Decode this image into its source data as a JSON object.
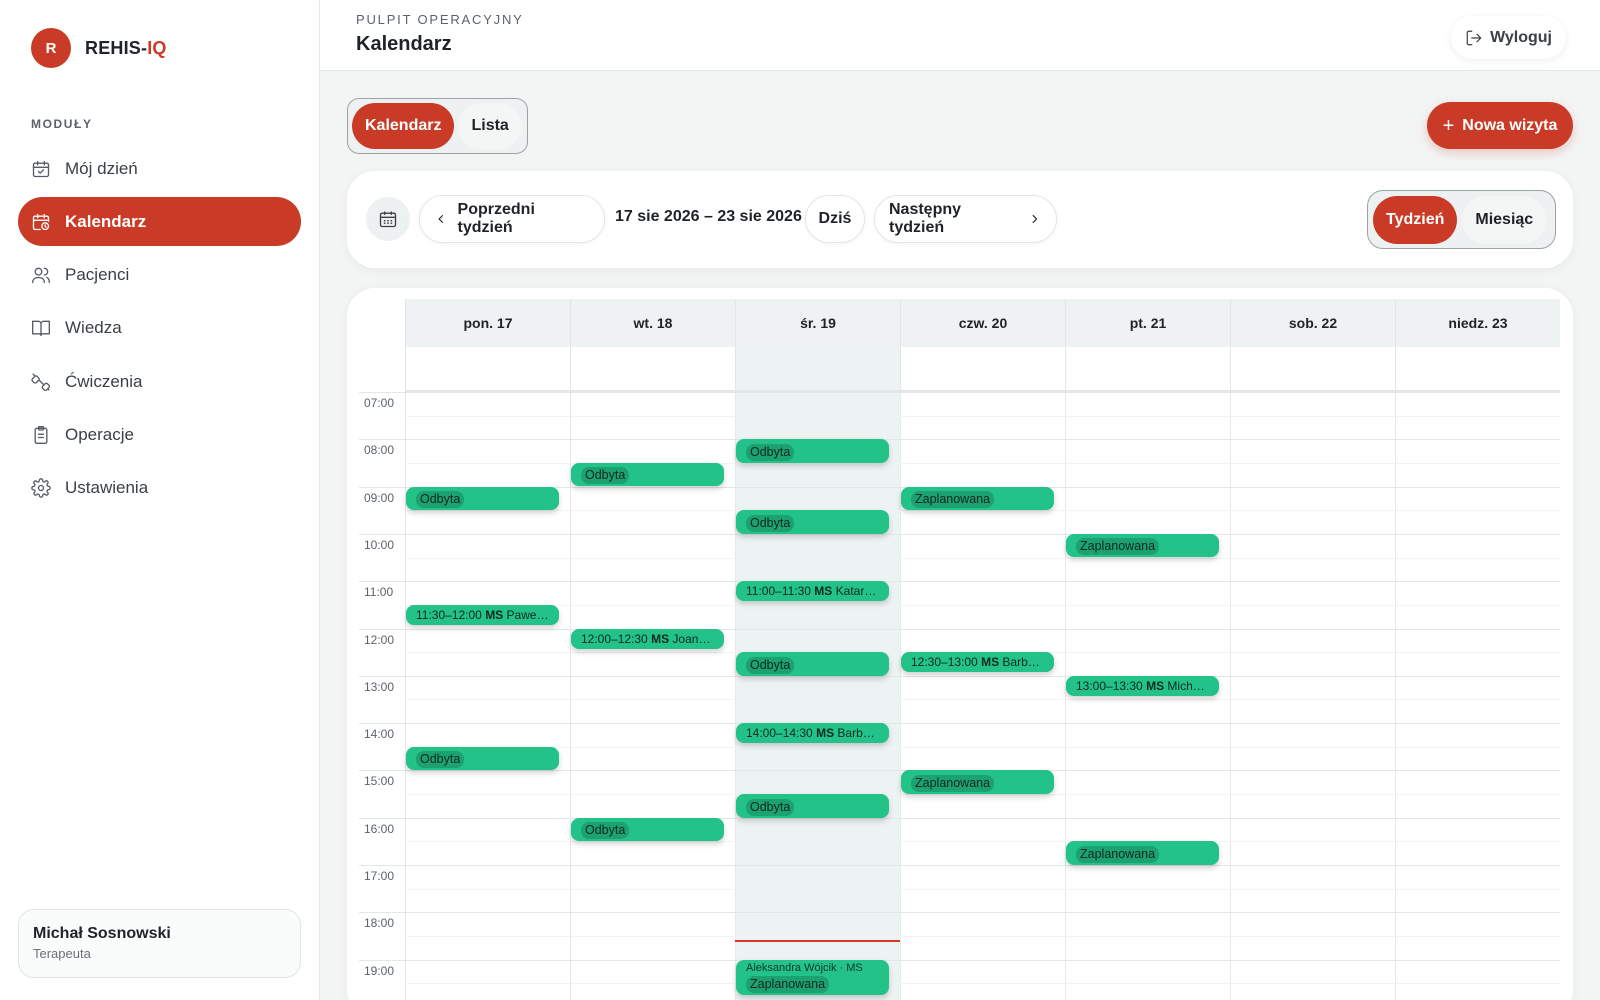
{
  "brand": {
    "initial": "R",
    "name_prefix": "REHIS-",
    "name_accent": "IQ"
  },
  "sidebar": {
    "section_label": "MODUŁY",
    "items": [
      {
        "label": "Mój dzień",
        "icon": "calendar-check-icon",
        "active": false
      },
      {
        "label": "Kalendarz",
        "icon": "calendar-clock-icon",
        "active": true
      },
      {
        "label": "Pacjenci",
        "icon": "users-icon",
        "active": false
      },
      {
        "label": "Wiedza",
        "icon": "book-icon",
        "active": false
      },
      {
        "label": "Ćwiczenia",
        "icon": "dumbbell-icon",
        "active": false
      },
      {
        "label": "Operacje",
        "icon": "clipboard-icon",
        "active": false
      },
      {
        "label": "Ustawienia",
        "icon": "gear-icon",
        "active": false
      }
    ],
    "user": {
      "name": "Michał Sosnowski",
      "role": "Terapeuta"
    }
  },
  "header": {
    "kicker": "PULPIT OPERACYJNY",
    "title": "Kalendarz",
    "logout_label": "Wyloguj"
  },
  "view_switch": {
    "calendar_label": "Kalendarz",
    "list_label": "Lista",
    "active": "Kalendarz"
  },
  "new_visit_label": "Nowa wizyta",
  "toolbar": {
    "prev_label": "Poprzedni tydzień",
    "range": "17 sie 2026 – 23 sie 2026",
    "today_label": "Dziś",
    "next_label": "Następny tydzień",
    "week_label": "Tydzień",
    "month_label": "Miesiąc",
    "active_period": "Tydzień"
  },
  "calendar": {
    "days": [
      "pon. 17",
      "wt. 18",
      "śr. 19",
      "czw. 20",
      "pt. 21",
      "sob. 22",
      "niedz. 23"
    ],
    "today_index": 2,
    "hours": [
      "07:00",
      "08:00",
      "09:00",
      "10:00",
      "11:00",
      "12:00",
      "13:00",
      "14:00",
      "15:00",
      "16:00",
      "17:00",
      "18:00",
      "19:00"
    ],
    "now_time": "18:35",
    "events": [
      {
        "day": 0,
        "start": "09:00",
        "end": "09:45",
        "status": "Odbyta"
      },
      {
        "day": 0,
        "start": "11:30",
        "end": "12:00",
        "time": "11:30–12:00",
        "initials": "MS",
        "patient": "Paweł…"
      },
      {
        "day": 0,
        "start": "14:30",
        "end": "15:15",
        "status": "Odbyta"
      },
      {
        "day": 1,
        "start": "08:30",
        "end": "09:15",
        "status": "Odbyta"
      },
      {
        "day": 1,
        "start": "12:00",
        "end": "12:30",
        "time": "12:00–12:30",
        "initials": "MS",
        "patient": "Joan…"
      },
      {
        "day": 1,
        "start": "16:00",
        "end": "16:45",
        "status": "Odbyta"
      },
      {
        "day": 2,
        "start": "08:00",
        "end": "08:45",
        "status": "Odbyta"
      },
      {
        "day": 2,
        "start": "09:30",
        "end": "10:15",
        "status": "Odbyta"
      },
      {
        "day": 2,
        "start": "11:00",
        "end": "11:30",
        "time": "11:00–11:30",
        "initials": "MS",
        "patient": "Katarz…"
      },
      {
        "day": 2,
        "start": "12:30",
        "end": "13:15",
        "status": "Odbyta"
      },
      {
        "day": 2,
        "start": "14:00",
        "end": "14:30",
        "time": "14:00–14:30",
        "initials": "MS",
        "patient": "Barb…"
      },
      {
        "day": 2,
        "start": "15:30",
        "end": "16:15",
        "status": "Odbyta"
      },
      {
        "day": 2,
        "start": "19:00",
        "end": "20:00",
        "status": "Zaplanowana",
        "overflow": "Aleksandra Wójcik · MS"
      },
      {
        "day": 3,
        "start": "09:00",
        "end": "09:45",
        "status": "Zaplanowana"
      },
      {
        "day": 3,
        "start": "12:30",
        "end": "13:00",
        "time": "12:30–13:00",
        "initials": "MS",
        "patient": "Barba…"
      },
      {
        "day": 3,
        "start": "15:00",
        "end": "15:45",
        "status": "Zaplanowana"
      },
      {
        "day": 4,
        "start": "10:00",
        "end": "10:45",
        "status": "Zaplanowana"
      },
      {
        "day": 4,
        "start": "13:00",
        "end": "13:30",
        "time": "13:00–13:30",
        "initials": "MS",
        "patient": "Mich…"
      },
      {
        "day": 4,
        "start": "16:30",
        "end": "17:15",
        "status": "Zaplanowana"
      }
    ]
  },
  "colors": {
    "accent": "#c93b26",
    "event_green": "#22c288",
    "now_line": "#d33a2a",
    "page_bg": "#f3f5f5"
  }
}
